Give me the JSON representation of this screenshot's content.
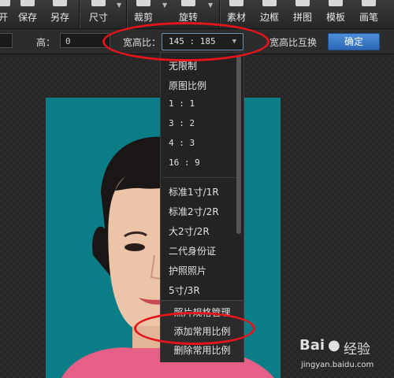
{
  "toolbar": {
    "items": [
      {
        "label": "开",
        "icon": "open-icon"
      },
      {
        "label": "保存",
        "icon": "save-icon"
      },
      {
        "label": "另存",
        "icon": "save-as-icon"
      },
      {
        "label": "尺寸",
        "icon": "resize-icon"
      },
      {
        "label": "裁剪",
        "icon": "crop-icon"
      },
      {
        "label": "旋转",
        "icon": "rotate-icon"
      },
      {
        "label": "素材",
        "icon": "material-icon"
      },
      {
        "label": "边框",
        "icon": "border-icon"
      },
      {
        "label": "拼图",
        "icon": "puzzle-icon"
      },
      {
        "label": "模板",
        "icon": "template-icon"
      },
      {
        "label": "画笔",
        "icon": "brush-icon"
      }
    ]
  },
  "options": {
    "height_label": "高：",
    "height_value": "0",
    "ratio_label": "宽高比：",
    "ratio_value": "145 : 185",
    "swap_label": "宽高比互换",
    "confirm_label": "确定"
  },
  "dropdown": {
    "group1": [
      "无限制",
      "原图比例",
      "1 : 1",
      "3 : 2",
      "4 : 3",
      "16 : 9"
    ],
    "group2": [
      "标准1寸/1R",
      "标准2寸/2R",
      "大2寸/2R",
      "二代身份证",
      "护照照片",
      "5寸/3R"
    ],
    "footer": [
      "照片规格管理",
      "添加常用比例",
      "删除常用比例"
    ]
  },
  "watermark": {
    "brand_a": "Bai",
    "brand_b": "经验",
    "url": "jingyan.baidu.com"
  },
  "colors": {
    "accent": "#2b67b5",
    "highlight_oval": "#e3141c",
    "photo_bg": "#0b7d86"
  }
}
